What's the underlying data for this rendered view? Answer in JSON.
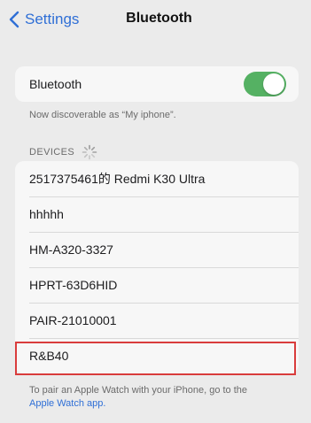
{
  "nav": {
    "back_label": "Settings",
    "title": "Bluetooth"
  },
  "bluetooth": {
    "label": "Bluetooth",
    "enabled": true,
    "discoverable_text": "Now discoverable as “My iphone”."
  },
  "devices": {
    "header": "DEVICES",
    "items": [
      {
        "name": "2517375461的 Redmi K30 Ultra"
      },
      {
        "name": "hhhhh"
      },
      {
        "name": "HM-A320-3327"
      },
      {
        "name": "HPRT-63D6HID"
      },
      {
        "name": "PAIR-21010001"
      },
      {
        "name": "R&B40"
      }
    ]
  },
  "footer": {
    "text": "To pair an Apple Watch with your iPhone, go to the",
    "link": "Apple Watch app."
  },
  "colors": {
    "accent": "#2f6fd6",
    "toggle_on": "#55b163",
    "highlight": "#d93c3c"
  },
  "icons": {
    "back": "chevron-left-icon",
    "loading": "spinner-icon"
  }
}
